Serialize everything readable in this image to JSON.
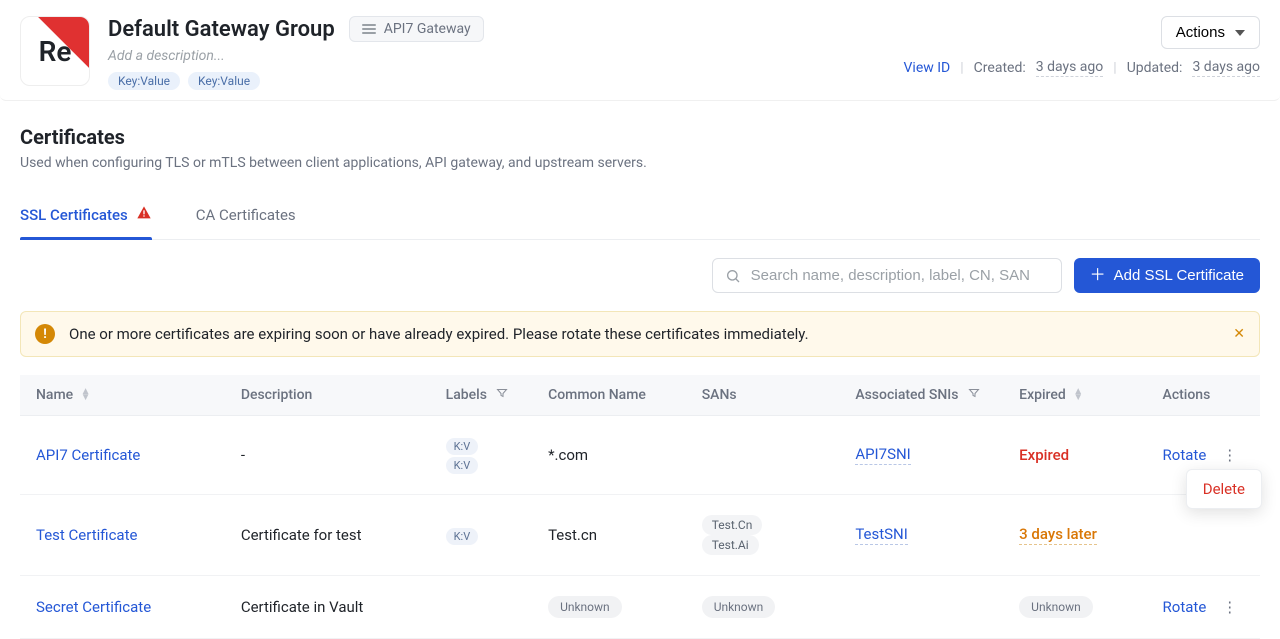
{
  "logo": {
    "text": "Re"
  },
  "header": {
    "title": "Default Gateway Group",
    "gateway_badge": "API7 Gateway",
    "description_placeholder": "Add a description...",
    "tags": [
      "Key:Value",
      "Key:Value"
    ]
  },
  "header_right": {
    "actions_label": "Actions",
    "view_id": "View ID",
    "created_label": "Created:",
    "created_value": "3 days ago",
    "updated_label": "Updated:",
    "updated_value": "3 days ago"
  },
  "section": {
    "title": "Certificates",
    "subtitle": "Used when configuring TLS or mTLS between client applications, API gateway, and upstream servers."
  },
  "tabs": {
    "ssl": "SSL Certificates",
    "ca": "CA Certificates"
  },
  "toolbar": {
    "search_placeholder": "Search name, description, label, CN, SAN",
    "add_button": "Add SSL Certificate"
  },
  "alert": {
    "text": "One or more certificates are expiring soon or have already expired. Please rotate these certificates immediately."
  },
  "table": {
    "columns": {
      "name": "Name",
      "description": "Description",
      "labels": "Labels",
      "cn": "Common Name",
      "sans": "SANs",
      "sni": "Associated SNIs",
      "expired": "Expired",
      "actions": "Actions"
    },
    "rows": [
      {
        "name": "API7 Certificate",
        "description": "-",
        "labels": [
          "K:V",
          "K:V"
        ],
        "cn": "*.com",
        "sans": [],
        "sni": "API7SNI",
        "expired": "Expired",
        "expired_style": "red",
        "action": "Rotate"
      },
      {
        "name": "Test Certificate",
        "description": "Certificate for test",
        "labels": [
          "K:V"
        ],
        "cn": "Test.cn",
        "sans": [
          "Test.Cn",
          "Test.Ai"
        ],
        "sni": "TestSNI",
        "expired": "3 days later",
        "expired_style": "orange",
        "action": ""
      },
      {
        "name": "Secret Certificate",
        "description": "Certificate in Vault",
        "labels": [],
        "cn": "Unknown",
        "cn_unknown": true,
        "sans_unknown": true,
        "sni": "",
        "expired": "Unknown",
        "expired_style": "unknown",
        "action": "Rotate"
      }
    ]
  },
  "popup": {
    "delete": "Delete"
  }
}
